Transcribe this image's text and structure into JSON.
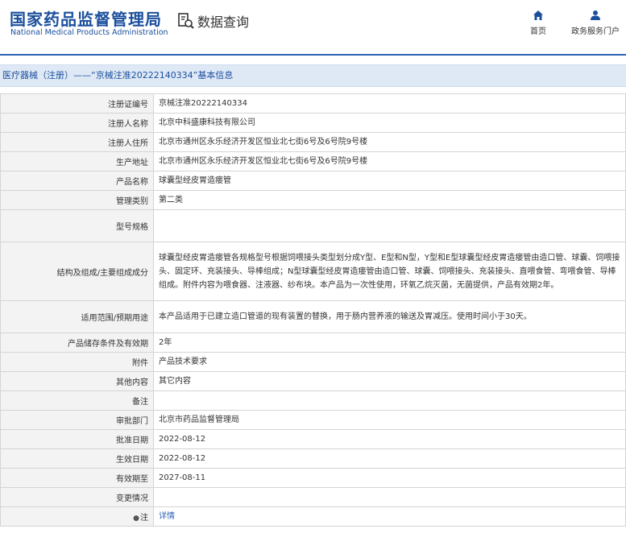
{
  "header": {
    "logo_cn": "国家药品监督管理局",
    "logo_en": "National Medical Products Administration",
    "query_label": "数据查询",
    "nav": {
      "home": "首页",
      "gov": "政务服务门户"
    },
    "brand_color": "#1b4f9c"
  },
  "page_title": "医疗器械（注册）——“京械注准20222140334”基本信息",
  "rows": [
    {
      "label": "注册证编号",
      "value": "京械注准20222140334"
    },
    {
      "label": "注册人名称",
      "value": "北京中科盛康科技有限公司"
    },
    {
      "label": "注册人住所",
      "value": "北京市通州区永乐经济开发区恒业北七街6号及6号院9号楼"
    },
    {
      "label": "生产地址",
      "value": "北京市通州区永乐经济开发区恒业北七街6号及6号院9号楼"
    },
    {
      "label": "产品名称",
      "value": "球囊型经皮胃造瘘管"
    },
    {
      "label": "管理类别",
      "value": "第二类"
    },
    {
      "label": "型号规格",
      "value": ""
    },
    {
      "label": "结构及组成/主要组成成分",
      "value": "球囊型经皮胃造瘘管各规格型号根据饲喂接头类型划分成Y型、E型和N型，Y型和E型球囊型经皮胃造瘘管由造口管、球囊、饲喂接头、固定环、充装接头、导棒组成；N型球囊型经皮胃造瘘管由造口管、球囊、饲喂接头、充装接头、直喂食管、弯喂食管、导棒组成。附件内容为喂食器、注液器、纱布块。本产品为一次性使用，环氧乙烷灭菌，无菌提供，产品有效期2年。"
    },
    {
      "label": "适用范围/预期用途",
      "value": "本产品适用于已建立造口管道的现有装置的替换，用于肠内营养液的输送及胃减压。使用时间小于30天。"
    },
    {
      "label": "产品储存条件及有效期",
      "value": "2年"
    },
    {
      "label": "附件",
      "value": "产品技术要求"
    },
    {
      "label": "其他内容",
      "value": "其它内容"
    },
    {
      "label": "备注",
      "value": ""
    },
    {
      "label": "审批部门",
      "value": "北京市药品监督管理局"
    },
    {
      "label": "批准日期",
      "value": "2022-08-12"
    },
    {
      "label": "生效日期",
      "value": "2022-08-12"
    },
    {
      "label": "有效期至",
      "value": "2027-08-11"
    },
    {
      "label": "变更情况",
      "value": ""
    },
    {
      "label": "注",
      "value": "详情"
    }
  ]
}
